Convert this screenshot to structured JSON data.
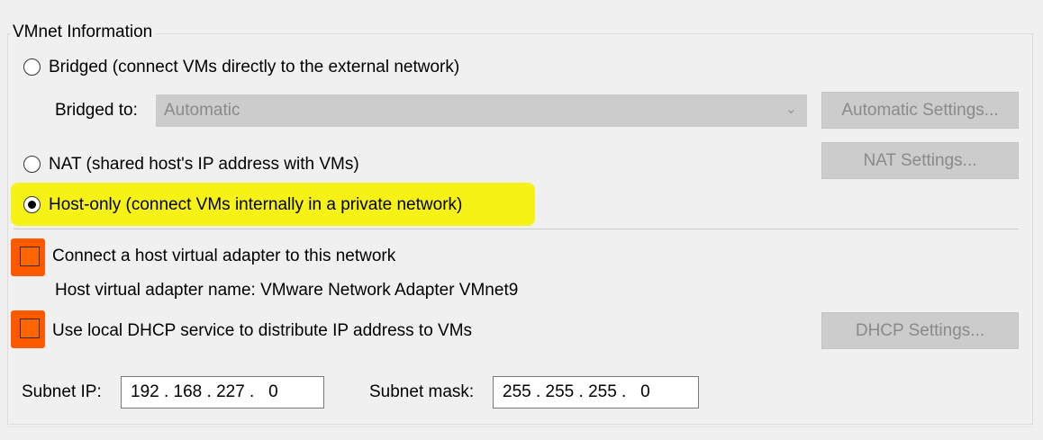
{
  "group": {
    "title": "VMnet Information"
  },
  "bridged": {
    "label": "Bridged (connect VMs directly to the external network)",
    "bridged_to_label": "Bridged to:",
    "bridged_to_value": "Automatic",
    "auto_settings_button": "Automatic Settings...",
    "selected": false
  },
  "nat": {
    "label": "NAT (shared host's IP address with VMs)",
    "settings_button": "NAT Settings...",
    "selected": false
  },
  "hostonly": {
    "label": "Host-only (connect VMs internally in a private network)",
    "selected": true
  },
  "connect_adapter": {
    "label": "Connect a host virtual adapter to this network",
    "checked": false
  },
  "adapter_name": {
    "text": "Host virtual adapter name: VMware Network Adapter VMnet9"
  },
  "dhcp": {
    "label": "Use local DHCP service to distribute IP address to VMs",
    "settings_button": "DHCP Settings...",
    "checked": false
  },
  "subnet": {
    "ip_label": "Subnet IP:",
    "ip_value": "192 . 168 . 227 .   0",
    "mask_label": "Subnet mask:",
    "mask_value": "255 . 255 . 255 .   0"
  },
  "colors": {
    "highlight": "#f6f215",
    "orange_mark": "#fd5a00",
    "disabled_bg": "#cccccc",
    "disabled_text": "#8a8a8a"
  }
}
